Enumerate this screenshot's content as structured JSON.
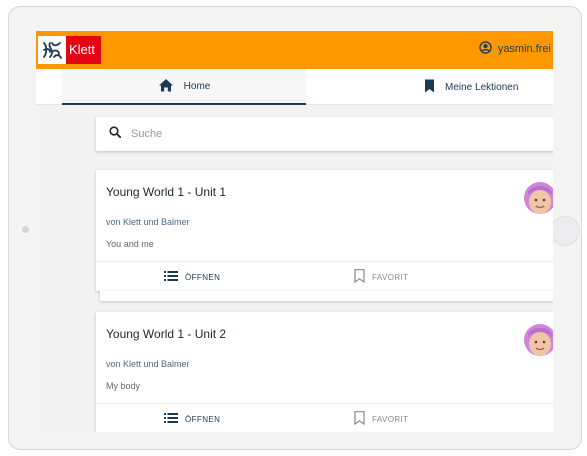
{
  "app": {
    "brand": "Klett",
    "username": "yasmin.frei"
  },
  "colors": {
    "header": "#ff9800",
    "brand_red": "#e30613",
    "primary": "#1b3a57"
  },
  "tabs": [
    {
      "label": "Home",
      "icon": "home-icon"
    },
    {
      "label": "Meine Lektionen",
      "icon": "bookmark-icon"
    }
  ],
  "search": {
    "placeholder": "Suche",
    "value": ""
  },
  "cards": [
    {
      "title": "Young World 1 - Unit 1",
      "author": "von Klett und Balmer",
      "subtitle": "You and me",
      "open_label": "ÖFFNEN",
      "favorite_label": "FAVORIT"
    },
    {
      "title": "Young World 1 - Unit 2",
      "author": "von Klett und Balmer",
      "subtitle": "My body",
      "open_label": "ÖFFNEN",
      "favorite_label": "FAVORIT"
    }
  ]
}
